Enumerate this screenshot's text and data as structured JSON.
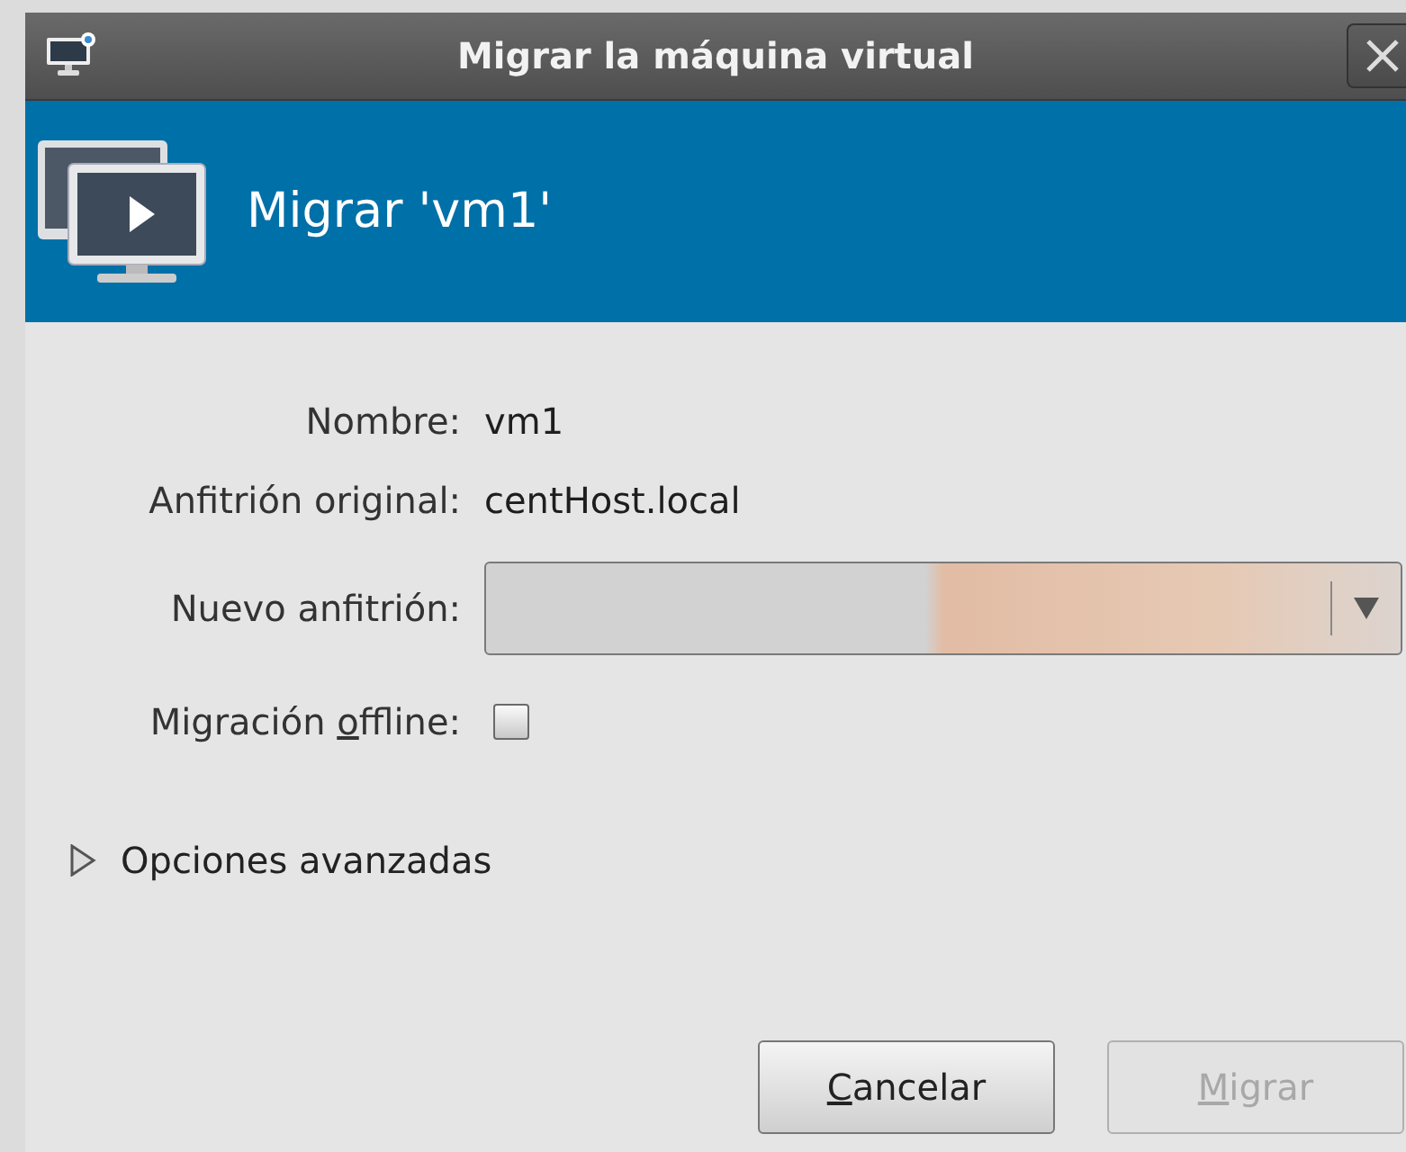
{
  "window": {
    "title": "Migrar la máquina virtual"
  },
  "header": {
    "title": "Migrar 'vm1'"
  },
  "fields": [
    {
      "kind": "text",
      "label": "Nombre:",
      "value": "vm1"
    },
    {
      "kind": "text",
      "label": "Anfitrión original:",
      "value": "centHost.local"
    },
    {
      "kind": "combo",
      "label": "Nuevo anfitrión:"
    },
    {
      "kind": "checkbox",
      "label_parts": [
        {
          "text": "Migración ",
          "underlined": false
        },
        {
          "text": "o",
          "underlined": true
        },
        {
          "text": "ffline:",
          "underlined": false
        }
      ],
      "checked": false
    }
  ],
  "expander": {
    "label": "Opciones avanzadas",
    "expanded": false
  },
  "buttons": [
    {
      "label_parts": [
        {
          "text": "C",
          "underlined": true
        },
        {
          "text": "ancelar",
          "underlined": false
        }
      ],
      "disabled": false
    },
    {
      "label_parts": [
        {
          "text": "M",
          "underlined": true
        },
        {
          "text": "igrar",
          "underlined": false
        }
      ],
      "disabled": true
    }
  ]
}
